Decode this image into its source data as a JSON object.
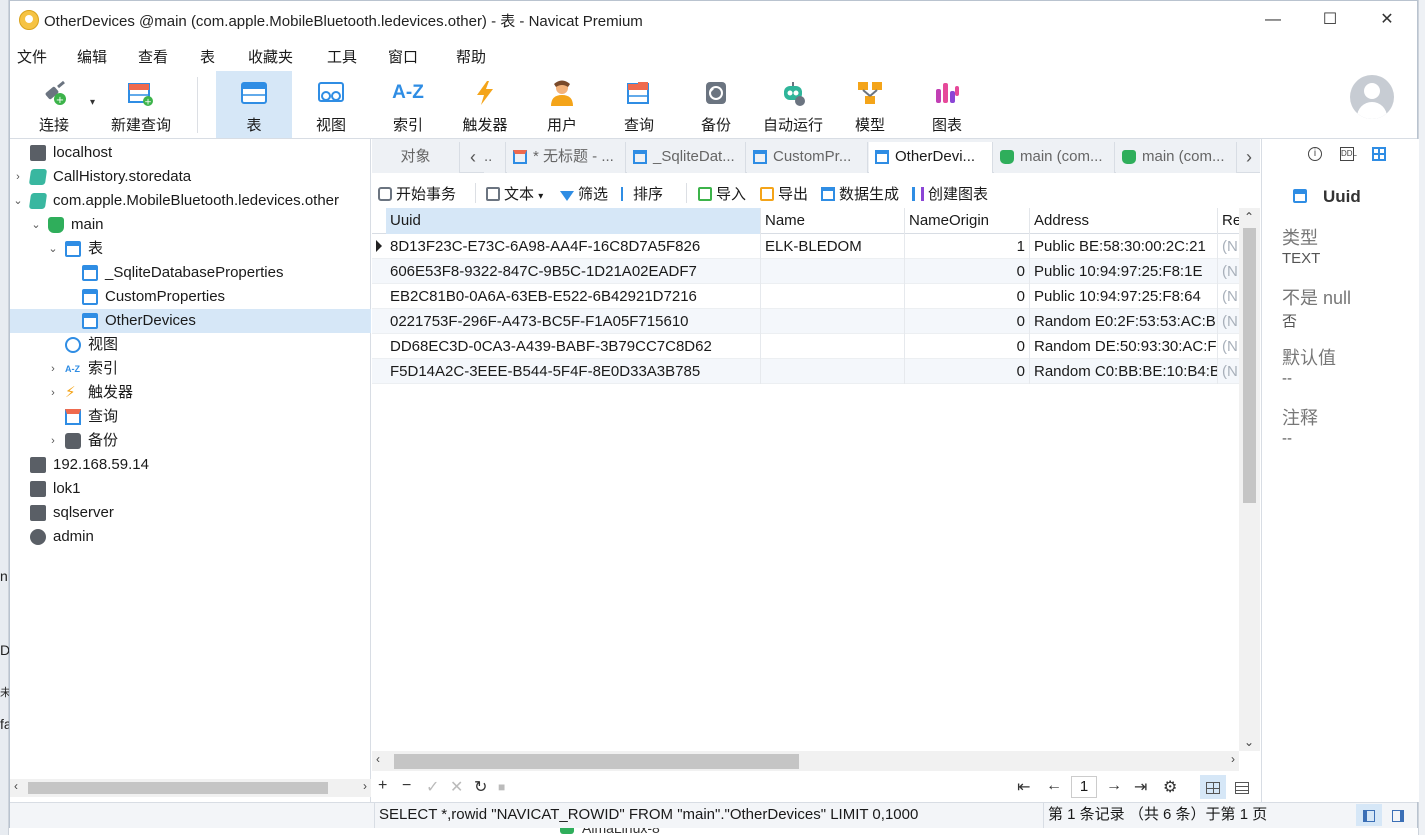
{
  "window": {
    "title": "OtherDevices @main (com.apple.MobileBluetooth.ledevices.other) - 表 - Navicat Premium",
    "controls": {
      "minimize": "—",
      "maximize": "☐",
      "close": "✕"
    }
  },
  "menu": [
    "文件",
    "编辑",
    "查看",
    "表",
    "收藏夹",
    "工具",
    "窗口",
    "帮助"
  ],
  "toolbar": {
    "connect": "连接",
    "new_query": "新建查询",
    "table": "表",
    "view": "视图",
    "index": "索引",
    "index_glyph": "A-Z",
    "trigger": "触发器",
    "user": "用户",
    "query": "查询",
    "backup": "备份",
    "automation": "自动运行",
    "model": "模型",
    "chart": "图表",
    "active": "table"
  },
  "nav": {
    "items": [
      {
        "label": "localhost",
        "icon": "server-icon",
        "level": 0,
        "arrow": ""
      },
      {
        "label": "CallHistory.storedata",
        "icon": "sqlite-icon",
        "level": 0,
        "arrow": "›"
      },
      {
        "label": "com.apple.MobileBluetooth.ledevices.other",
        "icon": "sqlite-icon",
        "level": 0,
        "arrow": "⌄"
      },
      {
        "label": "main",
        "icon": "database-icon",
        "level": 1,
        "arrow": "⌄"
      },
      {
        "label": "表",
        "icon": "table-group-icon",
        "level": 2,
        "arrow": "⌄"
      },
      {
        "label": "_SqliteDatabaseProperties",
        "icon": "table-icon",
        "level": 3,
        "arrow": ""
      },
      {
        "label": "CustomProperties",
        "icon": "table-icon",
        "level": 3,
        "arrow": ""
      },
      {
        "label": "OtherDevices",
        "icon": "table-icon",
        "level": 3,
        "arrow": "",
        "selected": true
      },
      {
        "label": "视图",
        "icon": "view-icon",
        "level": 2,
        "arrow": ""
      },
      {
        "label": "索引",
        "icon": "index-icon",
        "level": 2,
        "arrow": "›"
      },
      {
        "label": "触发器",
        "icon": "trigger-icon",
        "level": 2,
        "arrow": "›"
      },
      {
        "label": "查询",
        "icon": "query-icon",
        "level": 2,
        "arrow": ""
      },
      {
        "label": "备份",
        "icon": "backup-icon",
        "level": 2,
        "arrow": "›"
      },
      {
        "label": "192.168.59.14",
        "icon": "server-icon",
        "level": 0,
        "arrow": ""
      },
      {
        "label": "lok1",
        "icon": "server-icon",
        "level": 0,
        "arrow": ""
      },
      {
        "label": "sqlserver",
        "icon": "server-icon",
        "level": 0,
        "arrow": ""
      },
      {
        "label": "admin",
        "icon": "mongo-icon",
        "level": 0,
        "arrow": ""
      }
    ]
  },
  "tabs": {
    "objects": "对象",
    "items": [
      {
        "label": "..",
        "icon": "none"
      },
      {
        "label": "* 无标题 - ...",
        "icon": "query-icon"
      },
      {
        "label": "_SqliteDat...",
        "icon": "table-icon"
      },
      {
        "label": "CustomPr...",
        "icon": "table-icon"
      },
      {
        "label": "OtherDevi...",
        "icon": "table-icon",
        "active": true
      },
      {
        "label": "main (com...",
        "icon": "database-icon"
      },
      {
        "label": "main (com...",
        "icon": "database-icon"
      }
    ]
  },
  "data_toolbar": {
    "begin_transaction": "开始事务",
    "text": "文本",
    "filter": "筛选",
    "sort": "排序",
    "import": "导入",
    "export": "导出",
    "data_generation": "数据生成",
    "create_chart": "创建图表"
  },
  "grid": {
    "columns": [
      "Uuid",
      "Name",
      "NameOrigin",
      "Address",
      "Re"
    ],
    "rows": [
      [
        "8D13F23C-E73C-6A98-AA4F-16C8D7A5F826",
        "ELK-BLEDOM",
        "1",
        "Public BE:58:30:00:2C:21",
        "(N"
      ],
      [
        "606E53F8-9322-847C-9B5C-1D21A02EADF7",
        "",
        "0",
        "Public 10:94:97:25:F8:1E",
        "(N"
      ],
      [
        "EB2C81B0-0A6A-63EB-E522-6B42921D7216",
        "",
        "0",
        "Public 10:94:97:25:F8:64",
        "(N"
      ],
      [
        "0221753F-296F-A473-BC5F-F1A05F715610",
        "",
        "0",
        "Random E0:2F:53:53:AC:B",
        "(N"
      ],
      [
        "DD68EC3D-0CA3-A439-BABF-3B79CC7C8D62",
        "",
        "0",
        "Random DE:50:93:30:AC:F",
        "(N"
      ],
      [
        "F5D14A2C-3EEE-B544-5F4F-8E0D33A3B785",
        "",
        "0",
        "Random C0:BB:BE:10:B4:B",
        "(N"
      ]
    ]
  },
  "nav_bar": {
    "add": "+",
    "remove": "−",
    "apply": "✓",
    "discard": "✕",
    "refresh": "↻",
    "stop": "■",
    "first": "⇤",
    "prev": "←",
    "page": "1",
    "next": "→",
    "last": "⇥",
    "settings": "⚙"
  },
  "status": {
    "sql": "SELECT *,rowid \"NAVICAT_ROWID\" FROM \"main\".\"OtherDevices\" LIMIT 0,1000",
    "record": "第 1 条记录 （共 6 条）于第 1 页"
  },
  "info_panel": {
    "field_name": "Uuid",
    "type_label": "类型",
    "type_value": "TEXT",
    "not_null_label": "不是 null",
    "not_null_value": "否",
    "default_label": "默认值",
    "default_value": "--",
    "comment_label": "注释",
    "comment_value": "--"
  },
  "background": {
    "left_fragments": [
      "n",
      "D",
      "未",
      "fa"
    ],
    "bottom_item": "AlmaLinux-8"
  },
  "colors": {
    "accent": "#2f8de4",
    "selection": "#d6e7f7",
    "null_text": "#a8b0ba"
  }
}
